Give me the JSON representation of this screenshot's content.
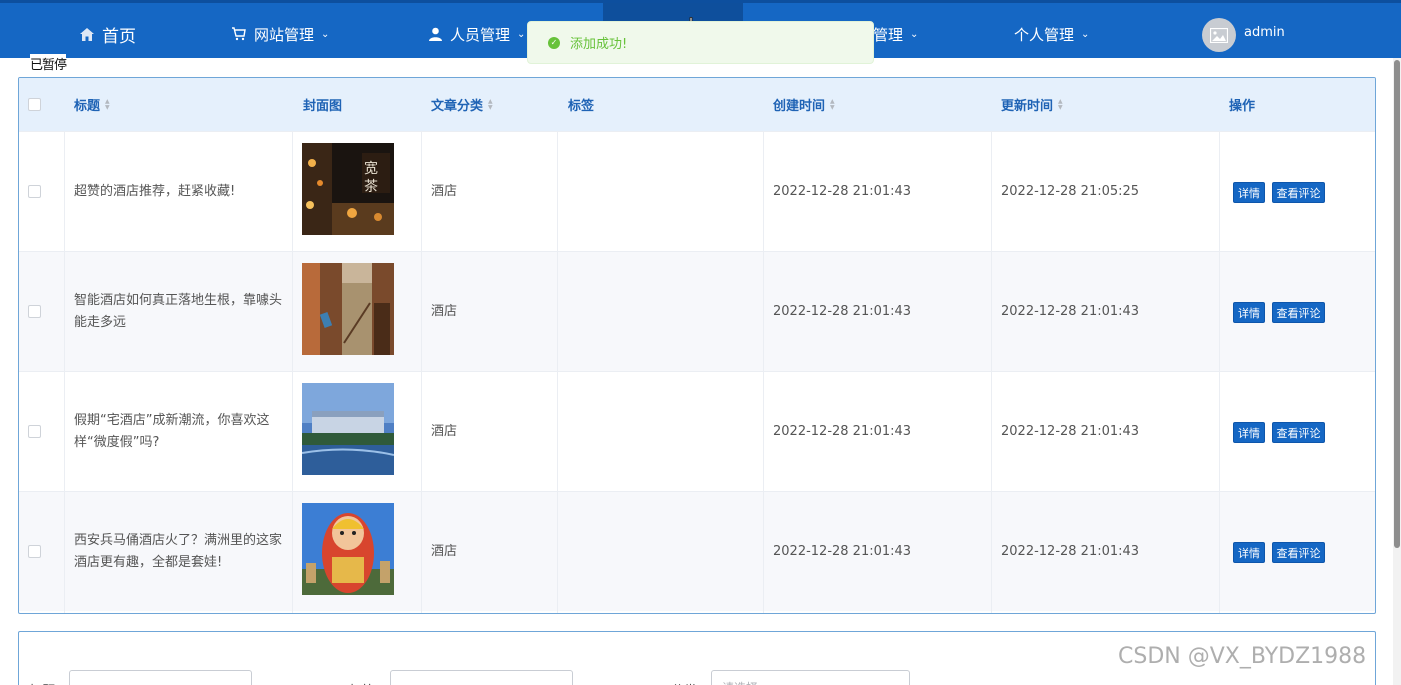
{
  "nav": {
    "home": "首页",
    "items": [
      {
        "label": "网站管理"
      },
      {
        "label": "人员管理"
      },
      {
        "label": "管理"
      },
      {
        "label": "个人管理"
      }
    ],
    "username": "admin"
  },
  "toast": {
    "message": "添加成功!"
  },
  "paused_label": "已暂停",
  "table": {
    "headers": {
      "title": "标题",
      "cover": "封面图",
      "category": "文章分类",
      "tags": "标签",
      "created": "创建时间",
      "updated": "更新时间",
      "actions": "操作"
    },
    "rows": [
      {
        "title": "超赞的酒店推荐，赶紧收藏!",
        "category": "酒店",
        "tags": "",
        "created": "2022-12-28 21:01:43",
        "updated": "2022-12-28 21:05:25"
      },
      {
        "title": "智能酒店如何真正落地生根，靠噱头能走多远",
        "category": "酒店",
        "tags": "",
        "created": "2022-12-28 21:01:43",
        "updated": "2022-12-28 21:01:43"
      },
      {
        "title": "假期“宅酒店”成新潮流，你喜欢这样“微度假”吗?",
        "category": "酒店",
        "tags": "",
        "created": "2022-12-28 21:01:43",
        "updated": "2022-12-28 21:01:43"
      },
      {
        "title": "西安兵马俑酒店火了？满洲里的这家酒店更有趣，全都是套娃!",
        "category": "酒店",
        "tags": "",
        "created": "2022-12-28 21:01:43",
        "updated": "2022-12-28 21:01:43"
      }
    ],
    "detail_label": "详情",
    "comments_label": "查看评论"
  },
  "search": {
    "title_label": "标题",
    "tags_label": "标签",
    "category_label": "分类",
    "category_placeholder": "请选择"
  },
  "watermark": "CSDN @VX_BYDZ1988"
}
